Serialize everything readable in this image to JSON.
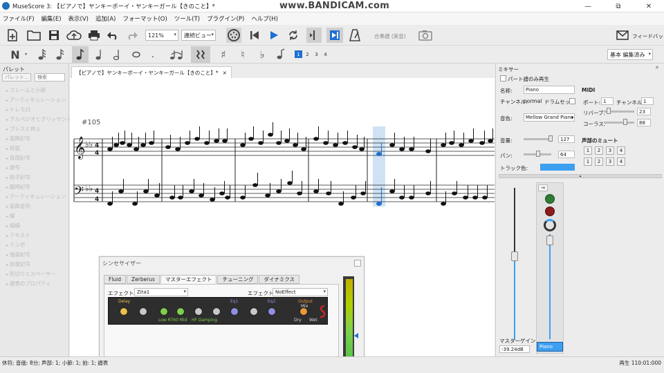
{
  "titlebar": {
    "title": "MuseScore 3: 【ピアノで】ヤンキーボーイ・ヤンキーガール【きのこと】*",
    "watermark": "www.BANDICAM.com",
    "minimize": "—",
    "maximize": "⧉",
    "close": "✕"
  },
  "menu": [
    "ファイル(F)",
    "編集(E)",
    "表示(V)",
    "追加(A)",
    "フォーマット(O)",
    "ツール(T)",
    "プラグイン(P)",
    "ヘルプ(H)"
  ],
  "toolbar": {
    "zoom": "121%",
    "view_mode": "連続ビュー",
    "concert_pitch": "合奏譜 (実音)",
    "feedback": "フィードバック",
    "workspace": "基本 編集済み",
    "voices": [
      "1",
      "2",
      "3",
      "4"
    ]
  },
  "palette": {
    "title": "パレット",
    "palette_button": "パレット...",
    "search_placeholder": "検索",
    "items": [
      "フレームと小節",
      "アーティキュレーション",
      "トレモロ",
      "アルペジオとグリッサンド",
      "ブレスと休止",
      "装飾記号",
      "括弧",
      "音部記号",
      "調号",
      "拍子記号",
      "臨時記号",
      "アーティキュレーション",
      "装飾音符",
      "線",
      "線線",
      "テキスト",
      "テンポ",
      "強弱記号",
      "反復記号",
      "区切りとスペーサー",
      "譜表のプロパティ"
    ]
  },
  "score": {
    "tab_label": "【ピアノで】ヤンキーボーイ・ヤンキーガール【きのこと】*",
    "tab_close": "×",
    "measure_number": "#105"
  },
  "mixer": {
    "title": "ミキサー",
    "part_only": "パート譜のみ再生",
    "name_label": "名称:",
    "name_value": "Piano",
    "channel_label": "チャンネル:",
    "channel_value": "normal",
    "drumset_label": "ドラムセット",
    "sound_label": "音色:",
    "sound_value": "Mellow Grand Piano",
    "volume_label": "音量:",
    "volume_value": "127",
    "pan_label": "パン:",
    "pan_value": "64",
    "track_color_label": "トラック色:",
    "track_color": "#3d9ff0",
    "midi_title": "MIDI",
    "port_label": "ポート:",
    "port_value": "1",
    "midi_channel_label": "チャンネル:",
    "midi_channel_value": "1",
    "reverb_label": "リバーブ:",
    "reverb_value": "23",
    "chorus_label": "コーラス:",
    "chorus_value": "88",
    "voice_mute_title": "声部のミュート",
    "mute_buttons_row1": [
      "1",
      "2",
      "3",
      "4"
    ],
    "mute_buttons_row2": [
      "1",
      "2",
      "3",
      "4"
    ],
    "master_gain_label": "マスターゲイン",
    "master_gain_value": "-39.24dB",
    "strip_label": "Piano"
  },
  "synth": {
    "title": "シンセサイザー",
    "tabs": [
      "Fluid",
      "Zerberus",
      "マスターエフェクト",
      "チューニング",
      "ダイナミクス"
    ],
    "effect_a_label": "エフェクトA:",
    "effect_a_value": "Zita1",
    "effect_b_label": "エフェクトB:",
    "effect_b_value": "NoEffect",
    "fx_labels": [
      "Delay",
      "Low RT60 Mid",
      "HF Damping",
      "Eq1",
      "Eq2",
      "Output",
      "Mix",
      "Dry",
      "Wet"
    ]
  },
  "status": {
    "left": "休符; 音価: 8分; 声部: 1; 小節: 1; 拍: 1; 譜表",
    "right": "再生 110:01:000"
  }
}
